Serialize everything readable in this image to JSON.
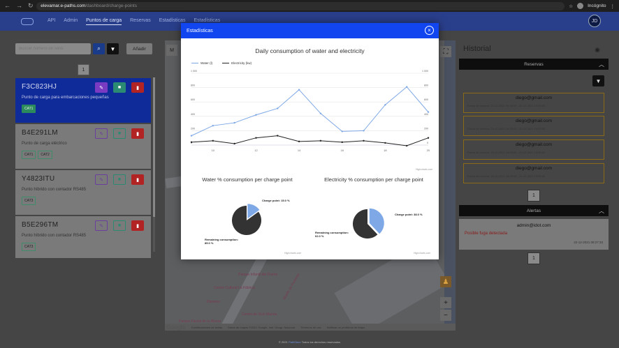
{
  "browser": {
    "url_host": "elevamar.e-paths.com",
    "url_path": "/dashboard/charge-points",
    "profile_label": "Incógnito"
  },
  "nav": {
    "items": [
      "API",
      "Admin",
      "Puntos de carga",
      "Reservas",
      "Estadísticas",
      "Estadísticas"
    ],
    "avatar_initials": "JD"
  },
  "left": {
    "search_placeholder": "Buscar número de serie",
    "add_label": "Añadir",
    "page_number": "1",
    "cards": [
      {
        "id": "F3C823HJ",
        "desc": "Punto de carga para embarcaciones pequeñas",
        "tags": [
          "CAT1"
        ],
        "selected": true
      },
      {
        "id": "B4E291LM",
        "desc": "Punto de carga eléctrico",
        "tags": [
          "CAT1",
          "CAT2"
        ],
        "selected": false
      },
      {
        "id": "Y4823ITU",
        "desc": "Punto híbrido con contador RS485",
        "tags": [
          "CAT3"
        ],
        "selected": false
      },
      {
        "id": "B5E296TM",
        "desc": "Punto híbrido con contador RS485",
        "tags": [
          "CAT3"
        ],
        "selected": false
      }
    ]
  },
  "map": {
    "labels": [
      "Parque Infantil del Puerto",
      "Centro Cultural La Fábrica",
      "Parque Fluvial de la Rivera",
      "Dársena",
      "Centro de Ocio Marina",
      "Muelle de Poniente"
    ],
    "footer": [
      "Combinaciones de teclas",
      "Datos de mapas ©2021 Google, Inst. Geogr. Nacional",
      "Términos de uso",
      "Notificar un problema de Maps"
    ]
  },
  "history": {
    "title": "Historial",
    "reservas_label": "Reservas",
    "reservas": [
      {
        "email": "diego@gmail.com",
        "date": "Fecha de reserva: 22-12-2021 09:30:00 - 22-12-2021 10:00:00"
      },
      {
        "email": "diego@gmail.com",
        "date": "Fecha de reserva: 23-12-2021 15:30:00 - 23-12-2021 16:00:00"
      },
      {
        "email": "diego@gmail.com",
        "date": "Fecha de reserva: 23-12-2021 19:00:00 - 23-12-2021 19:30:00"
      },
      {
        "email": "diego@gmail.com",
        "date": "Fecha de reserva: 24-12-2021 18:30:00 - 24-12-2021 19:00:00"
      }
    ],
    "reservas_page": "1",
    "alertas_label": "Alertas",
    "alert": {
      "email": "admin@idot.com",
      "message": "Posible fuga detectada",
      "date": "22-12-2021 08:27:33"
    },
    "alertas_page": "1"
  },
  "footer": {
    "prefix": "© 2021",
    "brand": "PathStore",
    "suffix": "Todos los derechos reservados"
  },
  "modal": {
    "title": "Estadísticas",
    "close_label": "×",
    "line_title": "Daily consumption of water and electricity",
    "credit": "Highcharts.com",
    "water_pie_title": "Water % consumption per charge point",
    "elec_pie_title": "Electricity % consumption per charge point",
    "water_pie_labels": [
      "Charge point: 15.0 %",
      "Remaining consumption: 85.0 %"
    ],
    "elec_pie_labels": [
      "Charge point: 38.0 %",
      "Remaining consumption: 62.0 %"
    ]
  },
  "colors": {
    "water": "#7fa8e6",
    "electricity": "#222222",
    "pie_dark": "#333333",
    "pie_light": "#7fa8e6",
    "accent": "#1045f0"
  },
  "chart_data": [
    {
      "type": "line",
      "title": "Daily consumption of water and electricity",
      "x": [
        9,
        10,
        11,
        12,
        13,
        14,
        15,
        16,
        17,
        18,
        19,
        20
      ],
      "x_ticks": [
        10,
        12,
        14,
        16,
        18,
        20
      ],
      "y_ticks": [
        0,
        200,
        400,
        600,
        800,
        1000
      ],
      "ylim": [
        0,
        1000
      ],
      "grid": true,
      "legend_position": "top-left",
      "series": [
        {
          "name": "Water (l)",
          "values": [
            130,
            270,
            310,
            420,
            510,
            770,
            440,
            190,
            200,
            560,
            810,
            460
          ]
        },
        {
          "name": "Electricity (kw)",
          "values": [
            40,
            60,
            20,
            100,
            130,
            50,
            60,
            40,
            60,
            30,
            -10,
            100
          ]
        }
      ]
    },
    {
      "type": "pie",
      "title": "Water % consumption per charge point",
      "labels": [
        "Charge point",
        "Remaining consumption"
      ],
      "values": [
        15.0,
        85.0
      ]
    },
    {
      "type": "pie",
      "title": "Electricity % consumption per charge point",
      "labels": [
        "Charge point",
        "Remaining consumption"
      ],
      "values": [
        38.0,
        62.0
      ]
    }
  ]
}
